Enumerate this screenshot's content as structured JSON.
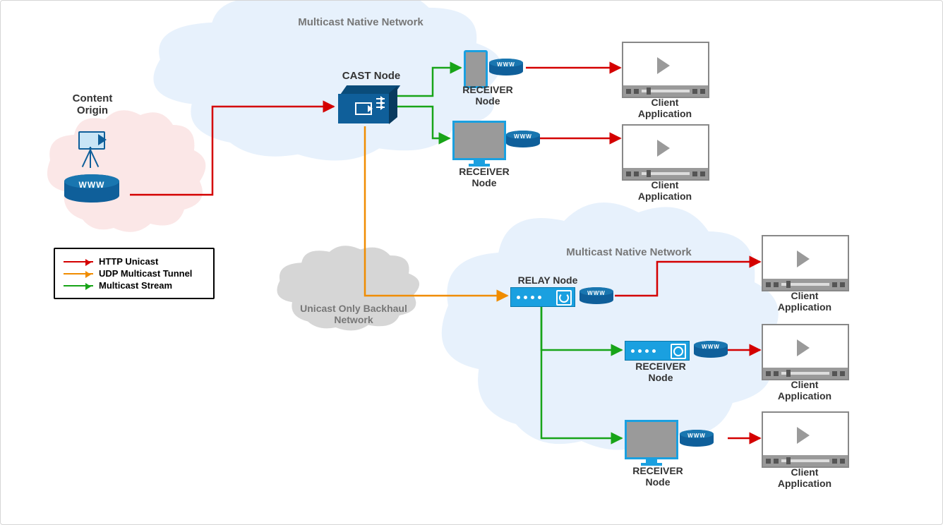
{
  "title_top": "Multicast Native Network",
  "title_right": "Multicast Native Network",
  "backhaul": "Unicast Only Backhaul\nNetwork",
  "origin": {
    "label": "Content\nOrigin",
    "www": "WWW"
  },
  "cast": {
    "label": "CAST Node"
  },
  "relay": {
    "label": "RELAY Node",
    "www": "WWW"
  },
  "receivers": {
    "r1": {
      "label": "RECEIVER\nNode",
      "www": "WWW"
    },
    "r2": {
      "label": "RECEIVER\nNode",
      "www": "WWW"
    },
    "r3": {
      "label": "RECEIVER\nNode",
      "www": "WWW"
    },
    "r4": {
      "label": "RECEIVER\nNode",
      "www": "WWW"
    }
  },
  "clients": {
    "c1": "Client\nApplication",
    "c2": "Client\nApplication",
    "c3": "Client\nApplication",
    "c4": "Client\nApplication",
    "c5": "Client\nApplication"
  },
  "legend": {
    "http": "HTTP Unicast",
    "udp": "UDP Multicast Tunnel",
    "mc": "Multicast Stream",
    "colors": {
      "http": "#d40000",
      "udp": "#f08c00",
      "mc": "#18a418"
    }
  }
}
